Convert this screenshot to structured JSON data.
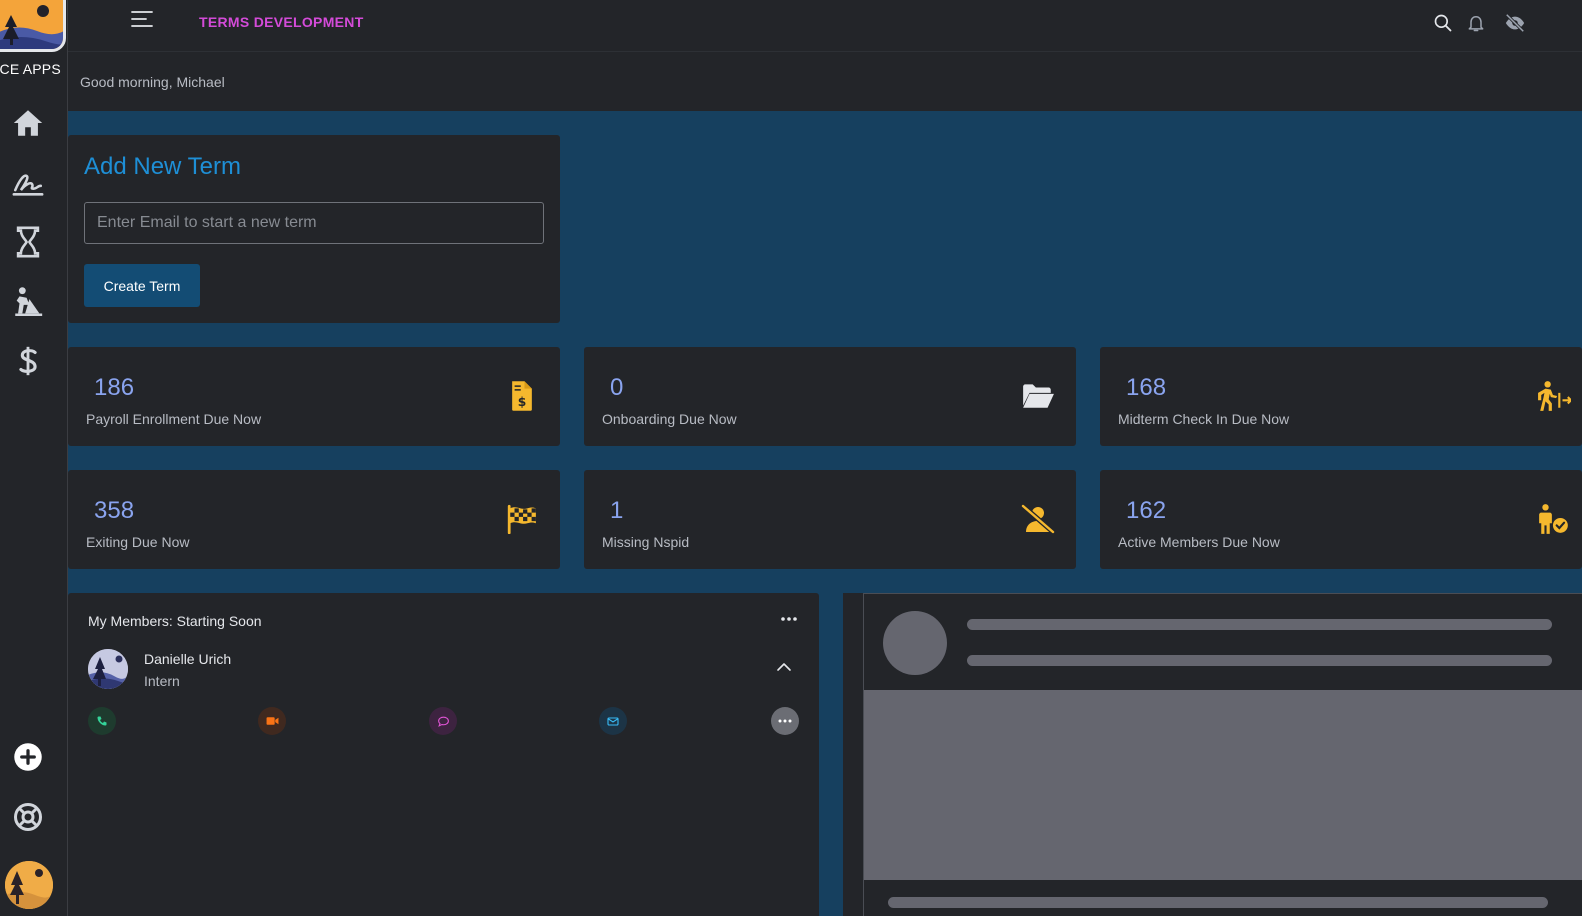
{
  "sidebar": {
    "brand": "ACE APPS",
    "nav_icons": [
      "home-icon",
      "signature-icon",
      "hourglass-icon",
      "person-digging-icon",
      "dollar-icon"
    ],
    "bottom_icons": [
      "add-circle-icon",
      "lifebuoy-icon"
    ]
  },
  "topbar": {
    "title": "TERMS DEVELOPMENT",
    "title_color": "#d44bd9",
    "icons": [
      "search-icon",
      "bell-icon",
      "eye-slash-icon"
    ]
  },
  "greeting": "Good morning, Michael",
  "add_term": {
    "title": "Add New Term",
    "placeholder": "Enter Email to start a new term",
    "value": "",
    "button_label": "Create Term"
  },
  "stats": [
    {
      "value": "186",
      "label": "Payroll Enrollment Due Now",
      "icon": "file-invoice-dollar-icon"
    },
    {
      "value": "0",
      "label": "Onboarding Due Now",
      "icon": "folder-open-icon"
    },
    {
      "value": "168",
      "label": "Midterm Check In Due Now",
      "icon": "person-walking-arrow-icon"
    },
    {
      "value": "358",
      "label": "Exiting Due Now",
      "icon": "checkered-flag-icon"
    },
    {
      "value": "1",
      "label": "Missing Nspid",
      "icon": "user-slash-icon"
    },
    {
      "value": "162",
      "label": "Active Members Due Now",
      "icon": "person-check-icon"
    }
  ],
  "members": {
    "title": "My Members: Starting Soon",
    "items": [
      {
        "name": "Danielle Urich",
        "role": "Intern"
      }
    ],
    "actions": [
      "phone-icon",
      "video-icon",
      "chat-icon",
      "email-icon",
      "more-icon"
    ]
  },
  "colors": {
    "accent_blue": "#1e8fd6",
    "stat_value": "#8aa4ef",
    "icon_yellow": "#f5b82e",
    "background": "#16405f",
    "panel": "#232529"
  }
}
